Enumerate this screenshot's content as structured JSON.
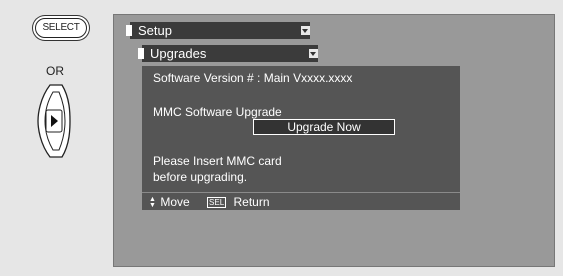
{
  "remote": {
    "select_label": "SELECT",
    "or_label": "OR",
    "nav_icon": "right-arrow-dial-icon"
  },
  "menu": {
    "setup_label": "Setup",
    "upgrades_label": "Upgrades"
  },
  "panel": {
    "software_version": "Software Version # : Main Vxxxx.xxxx",
    "mmc_upgrade_label": "MMC Software Upgrade",
    "upgrade_button": "Upgrade Now",
    "insert_line1": "Please Insert MMC card",
    "insert_line2": "before upgrading."
  },
  "footer": {
    "move_label": "Move",
    "sel_key": "SEL",
    "return_label": "Return"
  },
  "colors": {
    "screen_bg": "#999999",
    "menu_bar": "#3b3b3b",
    "panel_bg": "#555555"
  }
}
